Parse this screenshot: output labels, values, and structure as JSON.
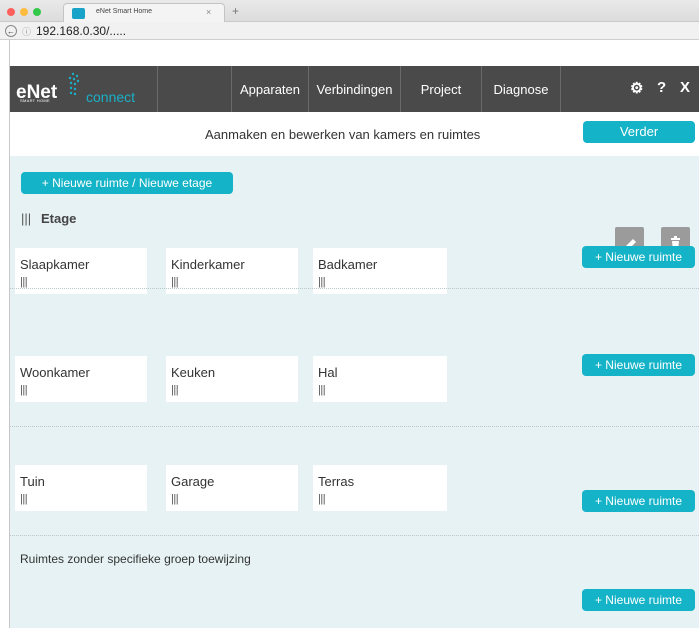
{
  "browser": {
    "tab_title": "eNet Smart Home",
    "tab_close": "×",
    "new_tab": "+",
    "back": "←",
    "info_icon": "ⓘ",
    "url": "192.168.0.30/....."
  },
  "header": {
    "logo_main": "eNet",
    "logo_sub": "SMART HOME",
    "logo_connect": "connect",
    "nav": [
      "Apparaten",
      "Verbindingen",
      "Project",
      "Diagnose"
    ],
    "settings_icon": "⚙",
    "help": "?",
    "close": "X"
  },
  "subheader": {
    "title": "Aanmaken en bewerken van kamers en ruimtes",
    "next_button": "Verder"
  },
  "main": {
    "new_room_floor_button": "+ Nieuwe ruimte / Nieuwe etage",
    "floor": {
      "handle": "|||",
      "label": "Etage"
    },
    "edit_icon": "✎",
    "delete_icon": "🗑",
    "groups": [
      {
        "rooms": [
          {
            "name": "Slaapkamer",
            "handle": "|||"
          },
          {
            "name": "Kinderkamer",
            "handle": "|||"
          },
          {
            "name": "Badkamer",
            "handle": "|||"
          }
        ],
        "add_button": "+ Nieuwe ruimte"
      },
      {
        "rooms": [
          {
            "name": "Woonkamer",
            "handle": "|||"
          },
          {
            "name": "Keuken",
            "handle": "|||"
          },
          {
            "name": "Hal",
            "handle": "|||"
          }
        ],
        "add_button": "+ Nieuwe ruimte"
      },
      {
        "rooms": [
          {
            "name": "Tuin",
            "handle": "|||"
          },
          {
            "name": "Garage",
            "handle": "|||"
          },
          {
            "name": "Terras",
            "handle": "|||"
          }
        ],
        "add_button": "+ Nieuwe ruimte"
      }
    ],
    "ungrouped": {
      "label": "Ruimtes zonder specifieke groep toewijzing",
      "add_button": "+ Nieuwe ruimte"
    }
  },
  "colors": {
    "accent": "#14b3c7",
    "header_bg": "#4a4a4a",
    "content_bg": "#e6f2f4"
  }
}
